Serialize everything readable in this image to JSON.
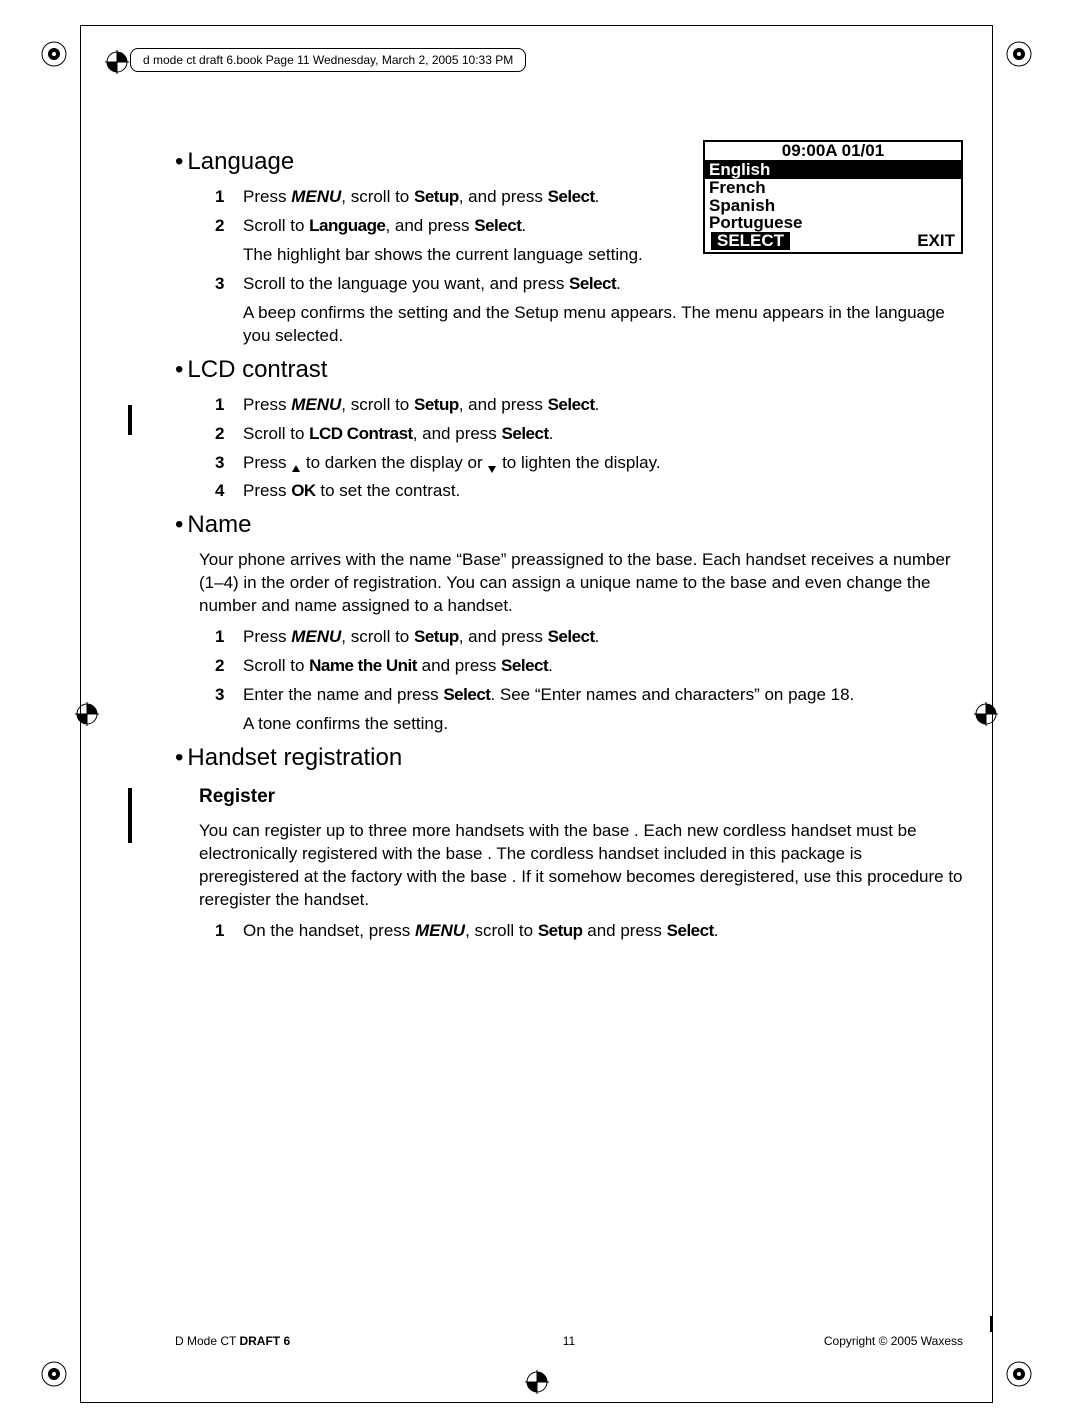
{
  "header": {
    "text": "d mode ct draft 6.book  Page 11  Wednesday, March 2, 2005  10:33 PM"
  },
  "sections": {
    "language": {
      "title": "Language",
      "steps": [
        {
          "num": "1",
          "parts": [
            "Press ",
            "MENU",
            ", scroll to ",
            "Setup",
            ", and press ",
            "Select",
            "."
          ]
        },
        {
          "num": "2",
          "parts": [
            "Scroll to ",
            "Language",
            ", and press ",
            "Select",
            "."
          ]
        },
        {
          "num": "3",
          "parts": [
            "Scroll to the language you want, and press ",
            "Select",
            "."
          ]
        }
      ],
      "sub1": "The highlight bar shows the current language setting.",
      "sub2": "A beep confirms the setting and the Setup menu appears. The menu appears in the language you selected."
    },
    "lcd_contrast": {
      "title": "LCD contrast",
      "steps": [
        {
          "num": "1",
          "parts": [
            "Press ",
            "MENU",
            ", scroll to ",
            "Setup",
            ", and press ",
            "Select",
            "."
          ]
        },
        {
          "num": "2",
          "parts": [
            "Scroll to ",
            "LCD Contrast",
            ", and press ",
            "Select",
            "."
          ]
        },
        {
          "num": "3",
          "text_a": "Press ",
          "text_b": " to darken the display or ",
          "text_c": " to lighten the display."
        },
        {
          "num": "4",
          "parts": [
            "Press ",
            "OK",
            " to set the contrast."
          ]
        }
      ]
    },
    "name": {
      "title": "Name",
      "intro": "Your phone arrives with the name “Base” preassigned to the base. Each handset receives a number (1–4) in the order of registration. You can assign a unique name to the base and even change the number and name assigned to a handset.",
      "steps": [
        {
          "num": "1",
          "parts": [
            "Press ",
            "MENU",
            ", scroll to ",
            "Setup",
            ", and press ",
            "Select",
            "."
          ]
        },
        {
          "num": "2",
          "parts": [
            "Scroll to ",
            "Name the Unit",
            " and press ",
            "Select",
            "."
          ]
        },
        {
          "num": "3",
          "parts": [
            "Enter the name and press ",
            "Select",
            ". See “Enter names and characters” on page 18."
          ]
        }
      ],
      "sub": "A tone confirms the setting."
    },
    "handset_reg": {
      "title": "Handset registration",
      "sub_title": "Register",
      "intro": "You can register up to three more handsets with the base . Each new cordless handset must be electronically registered with the base . The cordless handset included in this package is preregistered at the factory with the base . If it somehow becomes deregistered, use this procedure to reregister the handset.",
      "steps": [
        {
          "num": "1",
          "parts": [
            "On the handset, press ",
            "MENU",
            ", scroll to ",
            "Setup",
            " and press ",
            "Select",
            "."
          ]
        }
      ]
    }
  },
  "lcd": {
    "time": "09:00A 01/01",
    "rows": [
      "English",
      "French",
      "Spanish",
      "Portuguese"
    ],
    "select": "SELECT",
    "exit": "EXIT"
  },
  "footer": {
    "left_a": "D Mode CT ",
    "left_b": "DRAFT 6",
    "center": "11",
    "right": "Copyright © 2005 Waxess"
  }
}
